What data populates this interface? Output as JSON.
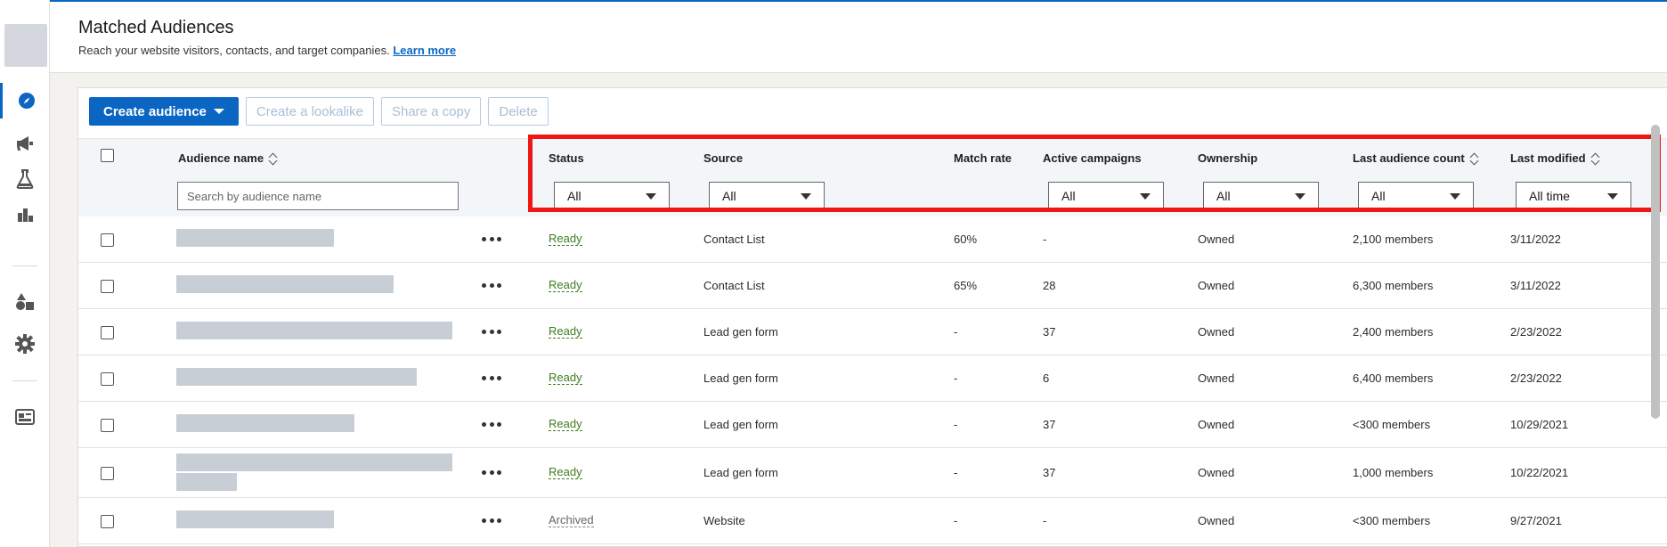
{
  "header": {
    "title": "Matched Audiences",
    "subtitle": "Reach your website visitors, contacts, and target companies.",
    "learn_more": "Learn more"
  },
  "rail": {
    "icons": [
      "compass-icon",
      "megaphone-icon",
      "flask-icon",
      "bar-chart-icon",
      "shapes-icon",
      "gear-icon",
      "id-card-icon"
    ]
  },
  "toolbar": {
    "create_audience": "Create audience",
    "create_lookalike": "Create a lookalike",
    "share_copy": "Share a copy",
    "delete": "Delete"
  },
  "columns": {
    "audience_name": "Audience name",
    "status": "Status",
    "source": "Source",
    "match_rate": "Match rate",
    "active_campaigns": "Active campaigns",
    "ownership": "Ownership",
    "last_audience_count": "Last audience count",
    "last_modified": "Last modified"
  },
  "filters": {
    "search_placeholder": "Search by audience name",
    "status": "All",
    "source": "All",
    "active_campaigns": "All",
    "ownership": "All",
    "last_audience_count": "All",
    "last_modified": "All time"
  },
  "rows": [
    {
      "status": "Ready",
      "source": "Contact List",
      "match_rate": "60%",
      "active_campaigns": "-",
      "ownership": "Owned",
      "count": "2,100 members",
      "modified": "3/11/2022"
    },
    {
      "status": "Ready",
      "source": "Contact List",
      "match_rate": "65%",
      "active_campaigns": "28",
      "ownership": "Owned",
      "count": "6,300 members",
      "modified": "3/11/2022"
    },
    {
      "status": "Ready",
      "source": "Lead gen form",
      "match_rate": "-",
      "active_campaigns": "37",
      "ownership": "Owned",
      "count": "2,400 members",
      "modified": "2/23/2022"
    },
    {
      "status": "Ready",
      "source": "Lead gen form",
      "match_rate": "-",
      "active_campaigns": "6",
      "ownership": "Owned",
      "count": "6,400 members",
      "modified": "2/23/2022"
    },
    {
      "status": "Ready",
      "source": "Lead gen form",
      "match_rate": "-",
      "active_campaigns": "37",
      "ownership": "Owned",
      "count": "<300 members",
      "modified": "10/29/2021"
    },
    {
      "status": "Ready",
      "source": "Lead gen form",
      "match_rate": "-",
      "active_campaigns": "37",
      "ownership": "Owned",
      "count": "1,000 members",
      "modified": "10/22/2021"
    },
    {
      "status": "Archived",
      "source": "Website",
      "match_rate": "-",
      "active_campaigns": "-",
      "ownership": "Owned",
      "count": "<300 members",
      "modified": "9/27/2021"
    }
  ],
  "colors": {
    "accent": "#0a66c2",
    "ready": "#3f7d20",
    "highlight": "#f01616"
  }
}
